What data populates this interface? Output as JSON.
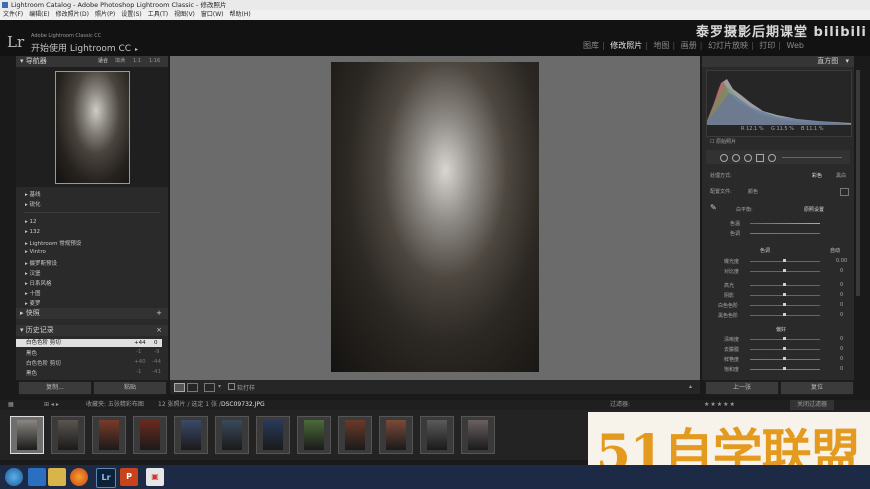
{
  "window": {
    "title": "Lightroom Catalog - Adobe Photoshop Lightroom Classic - 修改照片"
  },
  "menu": [
    "文件(F)",
    "编辑(E)",
    "修改照片(D)",
    "照片(P)",
    "设置(S)",
    "工具(T)",
    "视图(V)",
    "窗口(W)",
    "帮助(H)"
  ],
  "identity": {
    "logo": "Lr",
    "line1": "Adobe Lightroom Classic CC",
    "line2": "开始使用 Lightroom CC",
    "arrow": "▸",
    "brand": "泰罗摄影后期课堂 bilibili"
  },
  "modules": [
    {
      "label": "图库",
      "active": false
    },
    {
      "label": "修改照片",
      "active": true
    },
    {
      "label": "地图",
      "active": false
    },
    {
      "label": "画册",
      "active": false
    },
    {
      "label": "幻灯片放映",
      "active": false
    },
    {
      "label": "打印",
      "active": false
    },
    {
      "label": "Web",
      "active": false
    }
  ],
  "navigator": {
    "title": "导航器",
    "zoom_options": [
      "适合",
      "填满",
      "1:1",
      "1:16"
    ]
  },
  "presets": {
    "items": [
      "基线",
      "锐化",
      "12",
      "132",
      "Lightroom 常规预设",
      "Vintro",
      "摄罗斯预设",
      "汉堡",
      "日系风格",
      "十图",
      "麦罗"
    ]
  },
  "snapshots": {
    "title": "快照"
  },
  "history": {
    "title": "历史记录",
    "rows": [
      {
        "label": "白色色阶 剪切",
        "v1": "+44",
        "v2": "0"
      },
      {
        "label": "黑色",
        "v1": "-1",
        "v2": "-9"
      },
      {
        "label": "白色色阶 剪切",
        "v1": "+40",
        "v2": "-44"
      },
      {
        "label": "黑色",
        "v1": "-1",
        "v2": "-41"
      }
    ]
  },
  "left_buttons": {
    "copy": "复制...",
    "paste": "粘贴"
  },
  "toolbar": {
    "soft_proof": "软打样"
  },
  "histogram": {
    "title": "直方图",
    "r": "R",
    "r_val": "12.1",
    "g": "G",
    "g_val": "11.5",
    "b": "B",
    "b_val": "11.1",
    "pct": "%",
    "original": "原始照片"
  },
  "basic": {
    "treatment_label": "处理方式:",
    "color": "彩色",
    "bw": "黑白",
    "profile_label": "配置文件:",
    "profile_val": "颜色",
    "wb_label": "白平衡:",
    "wb_val": "原照设置",
    "temp": "色温",
    "tint": "色调",
    "tone": "色调",
    "auto": "自动",
    "sliders_tone": [
      {
        "label": "曝光度",
        "val": "0.00"
      },
      {
        "label": "对比度",
        "val": "0"
      },
      {
        "label": "高光",
        "val": "0"
      },
      {
        "label": "阴影",
        "val": "0"
      },
      {
        "label": "白色色阶",
        "val": "0"
      },
      {
        "label": "黑色色阶",
        "val": "0"
      }
    ],
    "presence": "偏好",
    "sliders_presence": [
      {
        "label": "清晰度",
        "val": "0"
      },
      {
        "label": "去朦胧",
        "val": "0"
      },
      {
        "label": "鲜艳度",
        "val": "0"
      },
      {
        "label": "饱和度",
        "val": "0"
      }
    ]
  },
  "right_buttons": {
    "previous": "上一张",
    "reset": "复位"
  },
  "filmstrip_bar": {
    "collection": "收藏夹: 五张精彩布图",
    "count": "12 张照片 / 选定 1 张 /",
    "file": "DSC09732.JPG",
    "filter_label": "过滤器:",
    "filter_val": "关闭过滤器"
  },
  "filmstrip": {
    "count": 12
  },
  "watermark": {
    "text": "51自学联盟"
  },
  "taskbar": {
    "icons": [
      "start",
      "explorer",
      "folder",
      "firefox",
      "lightroom",
      "powerpoint",
      "app"
    ]
  },
  "colors": {
    "accent": "#e39a1f",
    "panel": "#2a2a2a",
    "center": "#6b6b6b"
  }
}
